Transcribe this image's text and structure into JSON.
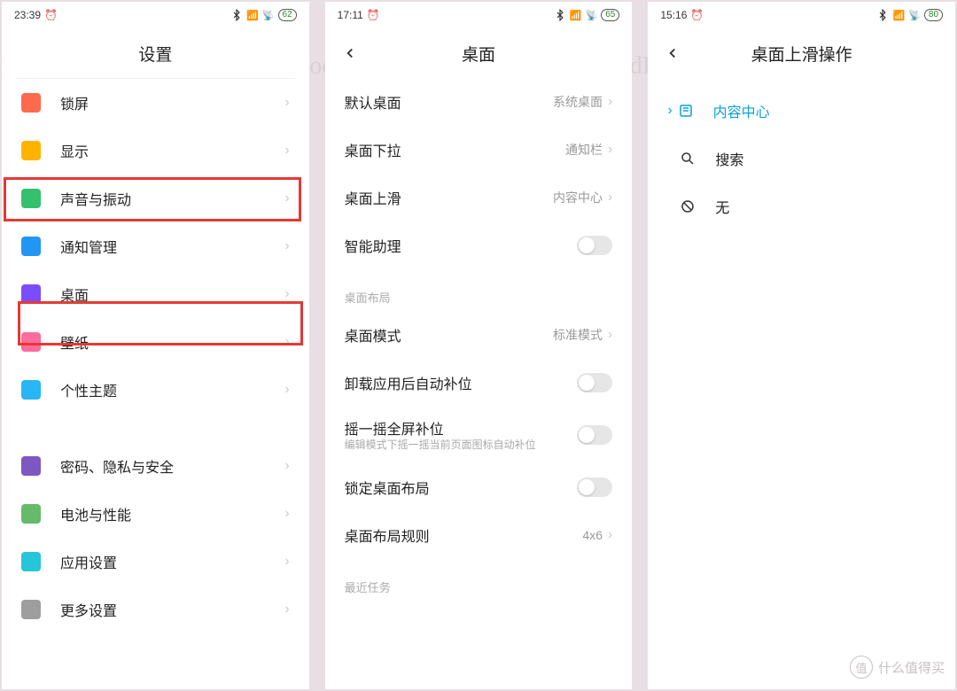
{
  "bg_text": "FoodLife FoodLife FoodLife FoodLife FoodLife FoodLife FoodLife FoodLife",
  "panel1": {
    "status": {
      "time": "23:39",
      "battery": "62"
    },
    "title": "设置",
    "items": [
      {
        "icon": "ic-lock",
        "name": "lock-icon",
        "label": "锁屏"
      },
      {
        "icon": "ic-disp",
        "name": "display-icon",
        "label": "显示"
      },
      {
        "icon": "ic-sound",
        "name": "sound-icon",
        "label": "声音与振动"
      },
      {
        "icon": "ic-notif",
        "name": "notification-icon",
        "label": "通知管理"
      },
      {
        "icon": "ic-home",
        "name": "home-icon",
        "label": "桌面"
      },
      {
        "icon": "ic-wall",
        "name": "wallpaper-icon",
        "label": "壁纸"
      },
      {
        "icon": "ic-theme",
        "name": "theme-icon",
        "label": "个性主题"
      },
      {
        "icon": "ic-sec",
        "name": "security-icon",
        "label": "密码、隐私与安全"
      },
      {
        "icon": "ic-batt",
        "name": "battery-icon",
        "label": "电池与性能"
      },
      {
        "icon": "ic-apps",
        "name": "apps-icon",
        "label": "应用设置"
      },
      {
        "icon": "ic-more",
        "name": "more-icon",
        "label": "更多设置"
      }
    ]
  },
  "panel2": {
    "status": {
      "time": "17:11",
      "battery": "65"
    },
    "title": "桌面",
    "rows": {
      "default_launcher": {
        "label": "默认桌面",
        "value": "系统桌面"
      },
      "pull_down": {
        "label": "桌面下拉",
        "value": "通知栏"
      },
      "swipe_up": {
        "label": "桌面上滑",
        "value": "内容中心"
      },
      "assistant": {
        "label": "智能助理"
      }
    },
    "section_layout": "桌面布局",
    "layout_rows": {
      "mode": {
        "label": "桌面模式",
        "value": "标准模式"
      },
      "autofill": {
        "label": "卸载应用后自动补位"
      },
      "shake": {
        "label": "摇一摇全屏补位",
        "sub": "编辑模式下摇一摇当前页面图标自动补位"
      },
      "lock": {
        "label": "锁定桌面布局"
      },
      "grid": {
        "label": "桌面布局规则",
        "value": "4x6"
      }
    },
    "section_recent": "最近任务"
  },
  "panel3": {
    "status": {
      "time": "15:16",
      "battery": "80"
    },
    "title": "桌面上滑操作",
    "options": [
      {
        "name": "content-center",
        "icon": "⎋",
        "label": "内容中心",
        "selected": true
      },
      {
        "name": "search",
        "icon": "search",
        "label": "搜索",
        "selected": false
      },
      {
        "name": "none",
        "icon": "none",
        "label": "无",
        "selected": false
      }
    ]
  },
  "watermark": "什么值得买"
}
